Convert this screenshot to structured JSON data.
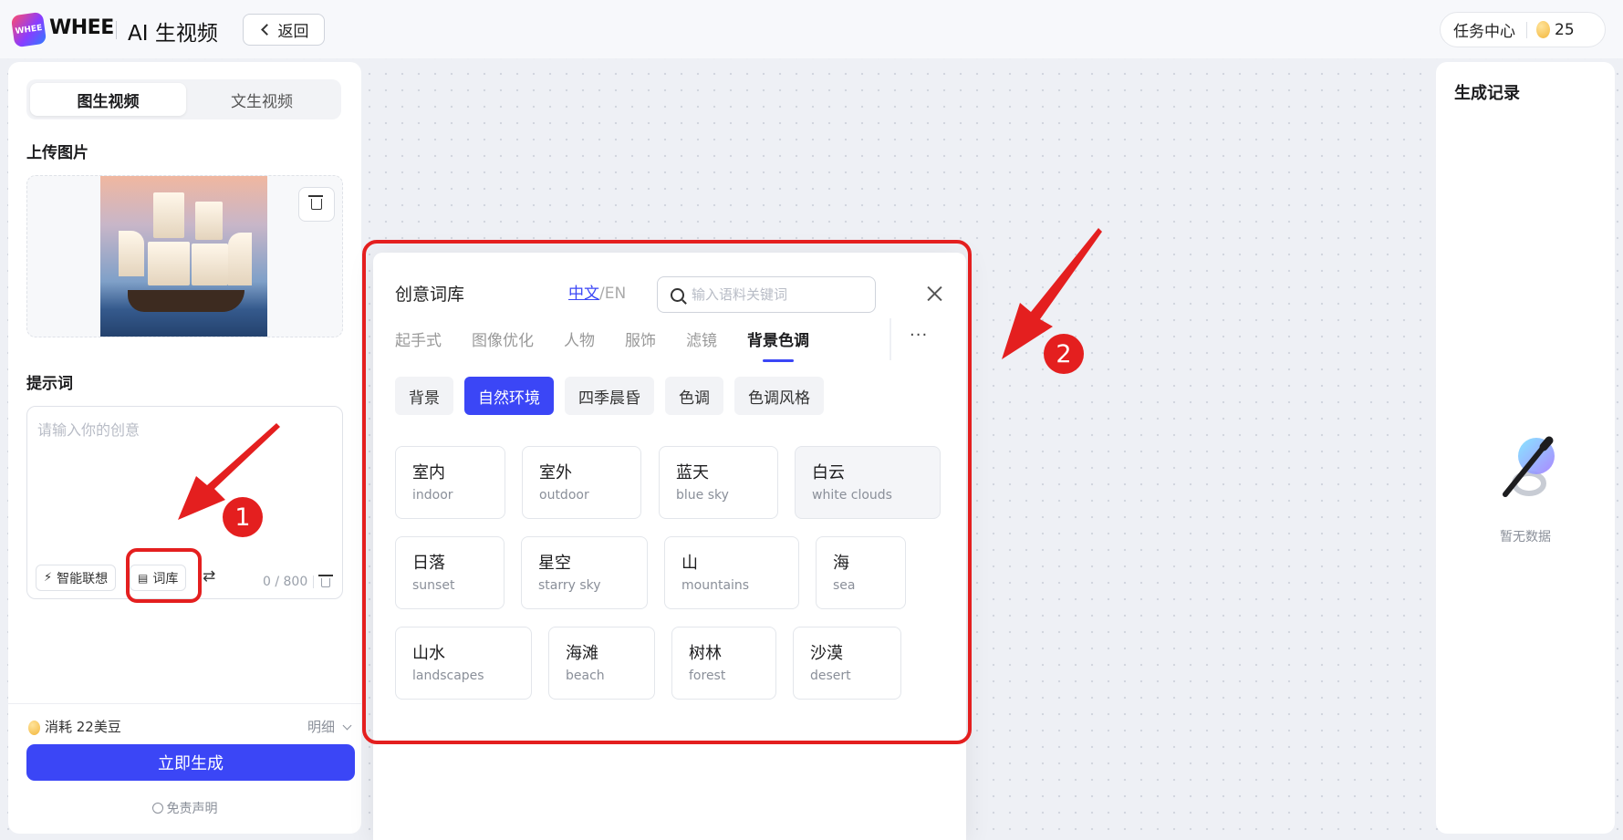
{
  "header": {
    "logo_text": "WHEE",
    "brand": "WHEE",
    "app_title": "AI 生视频",
    "back_label": "返回",
    "task_center": "任务中心",
    "bean_count": "25"
  },
  "left_panel": {
    "tabs": [
      "图生视频",
      "文生视频"
    ],
    "upload_label": "上传图片",
    "prompt_label": "提示词",
    "prompt_placeholder": "请输入你的创意",
    "smart_assoc": "智能联想",
    "lexicon": "词库",
    "counter": "0 / 800",
    "cost": "消耗 22美豆",
    "detail": "明细",
    "generate": "立即生成",
    "disclaimer": "免责声明"
  },
  "right_panel": {
    "title": "生成记录",
    "empty": "暂无数据"
  },
  "popup": {
    "title": "创意词库",
    "lang_zh": "中文",
    "lang_sep": "/",
    "lang_en": "EN",
    "search_placeholder": "输入语料关键词",
    "more": "···",
    "tabs": [
      "起手式",
      "图像优化",
      "人物",
      "服饰",
      "滤镜",
      "背景色调"
    ],
    "active_tab": "背景色调",
    "subtabs": [
      "背景",
      "自然环境",
      "四季晨昏",
      "色调",
      "色调风格"
    ],
    "active_subtab": "自然环境",
    "cards": [
      [
        {
          "zh": "室内",
          "en": "indoor"
        },
        {
          "zh": "室外",
          "en": "outdoor"
        },
        {
          "zh": "蓝天",
          "en": "blue sky"
        },
        {
          "zh": "白云",
          "en": "white clouds"
        }
      ],
      [
        {
          "zh": "日落",
          "en": "sunset"
        },
        {
          "zh": "星空",
          "en": "starry sky"
        },
        {
          "zh": "山",
          "en": "mountains"
        },
        {
          "zh": "海",
          "en": "sea"
        }
      ],
      [
        {
          "zh": "山水",
          "en": "landscapes"
        },
        {
          "zh": "海滩",
          "en": "beach"
        },
        {
          "zh": "树林",
          "en": "forest"
        },
        {
          "zh": "沙漠",
          "en": "desert"
        }
      ]
    ]
  },
  "annotations": {
    "badge_1": "1",
    "badge_2": "2"
  },
  "colors": {
    "accent": "#3b46f6",
    "annotation_red": "#e41f1f"
  }
}
